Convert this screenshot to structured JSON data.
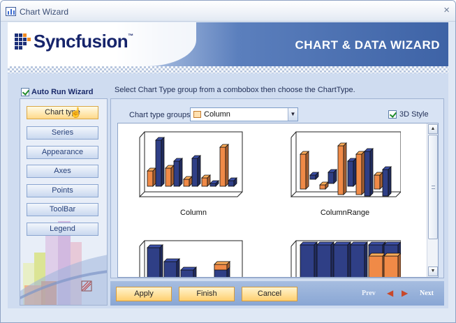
{
  "window": {
    "title": "Chart Wizard",
    "close_glyph": "×"
  },
  "banner": {
    "logo_text": "Syncfusion",
    "logo_tm": "™",
    "title": "CHART & DATA WIZARD"
  },
  "auto_run": {
    "label": "Auto Run Wizard",
    "checked": true
  },
  "instruction": "Select Chart Type group from a combobox then choose the ChartType.",
  "nav": {
    "items": [
      "Chart type",
      "Series",
      "Appearance",
      "Axes",
      "Points",
      "ToolBar",
      "Legend"
    ],
    "active_index": 0
  },
  "chart_type_groups": {
    "label": "Chart type groups",
    "selected": "Column"
  },
  "style_3d": {
    "label": "3D Style",
    "checked": true
  },
  "gallery": {
    "items": [
      {
        "label": "Column",
        "icon": "column-chart-icon"
      },
      {
        "label": "ColumnRange",
        "icon": "column-range-chart-icon"
      },
      {
        "label": "",
        "icon": "stacked-column-chart-icon"
      },
      {
        "label": "",
        "icon": "stacked-column-100-chart-icon"
      }
    ]
  },
  "actions": {
    "apply": "Apply",
    "finish": "Finish",
    "cancel": "Cancel"
  },
  "pager": {
    "prev": "Prev",
    "next": "Next"
  },
  "colors": {
    "series_blue": "#2f3f86",
    "series_orange": "#f08a47",
    "accent": "#3e63a6"
  }
}
